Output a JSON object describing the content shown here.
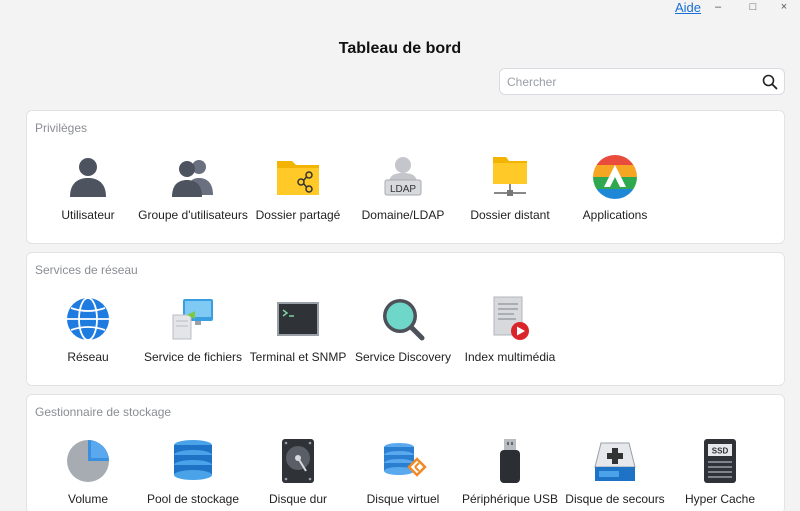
{
  "window": {
    "help_label": "Aide",
    "minimize_glyph": "–",
    "maximize_glyph": "□",
    "close_glyph": "×"
  },
  "page": {
    "title": "Tableau de bord"
  },
  "search": {
    "placeholder": "Chercher",
    "value": ""
  },
  "sections": [
    {
      "title": "Privilèges",
      "items": [
        {
          "label": "Utilisateur",
          "icon": "user-icon"
        },
        {
          "label": "Groupe d'utilisateurs",
          "icon": "user-group-icon"
        },
        {
          "label": "Dossier partagé",
          "icon": "shared-folder-icon"
        },
        {
          "label": "Domaine/LDAP",
          "icon": "ldap-icon"
        },
        {
          "label": "Dossier distant",
          "icon": "remote-folder-icon"
        },
        {
          "label": "Applications",
          "icon": "applications-icon"
        }
      ]
    },
    {
      "title": "Services de réseau",
      "items": [
        {
          "label": "Réseau",
          "icon": "network-globe-icon"
        },
        {
          "label": "Service de fichiers",
          "icon": "file-service-icon"
        },
        {
          "label": "Terminal et SNMP",
          "icon": "terminal-icon"
        },
        {
          "label": "Service Discovery",
          "icon": "discovery-magnifier-icon"
        },
        {
          "label": "Index multimédia",
          "icon": "media-index-icon"
        }
      ]
    },
    {
      "title": "Gestionnaire de stockage",
      "items": [
        {
          "label": "Volume",
          "icon": "volume-pie-icon"
        },
        {
          "label": "Pool de stockage",
          "icon": "storage-pool-icon"
        },
        {
          "label": "Disque dur",
          "icon": "hard-disk-icon"
        },
        {
          "label": "Disque virtuel",
          "icon": "virtual-disk-icon"
        },
        {
          "label": "Périphérique USB",
          "icon": "usb-device-icon"
        },
        {
          "label": "Disque de secours",
          "icon": "spare-disk-icon"
        },
        {
          "label": "Hyper Cache",
          "icon": "ssd-cache-icon"
        }
      ]
    }
  ]
}
